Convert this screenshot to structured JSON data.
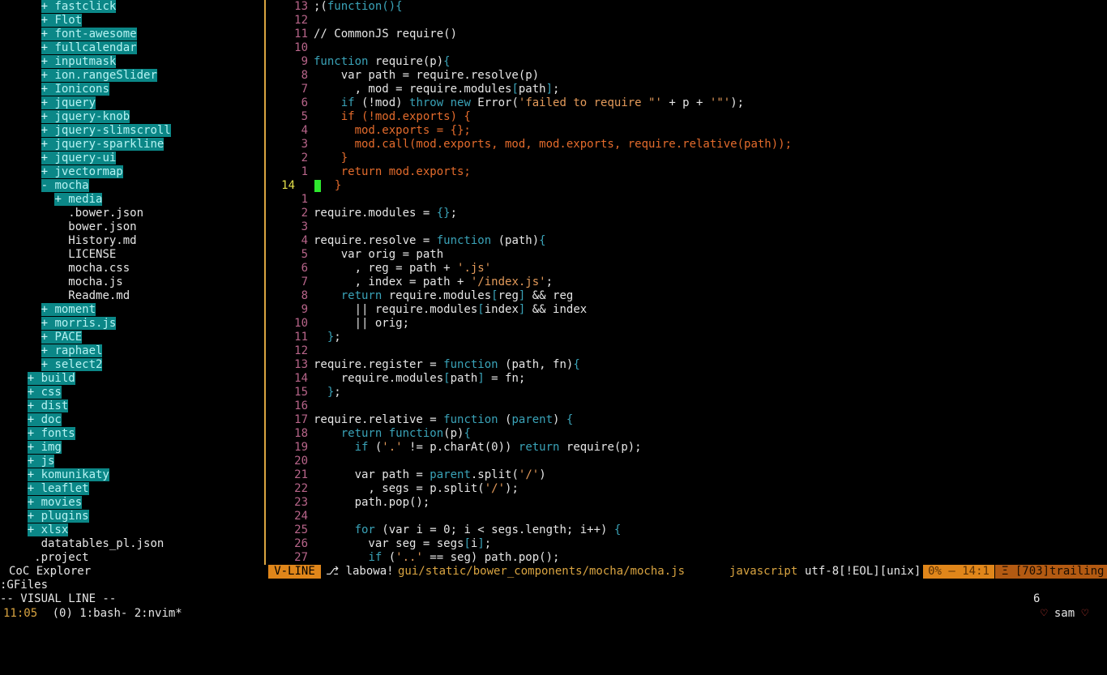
{
  "colors": {
    "accent": "#d9a441",
    "dir_bg": "#0b8787",
    "keyword": "#3aa3b8",
    "string": "#e39a5a",
    "visual": "#e36b2c",
    "line_number": "#b8658a",
    "cursor": "#2ee82e"
  },
  "explorer": {
    "title": "CoC Explorer",
    "rows": [
      {
        "indent": "      ",
        "sign": "+",
        "name": "fastclick",
        "type": "dir"
      },
      {
        "indent": "      ",
        "sign": "+",
        "name": "Flot",
        "type": "dir"
      },
      {
        "indent": "      ",
        "sign": "+",
        "name": "font-awesome",
        "type": "dir"
      },
      {
        "indent": "      ",
        "sign": "+",
        "name": "fullcalendar",
        "type": "dir"
      },
      {
        "indent": "      ",
        "sign": "+",
        "name": "inputmask",
        "type": "dir"
      },
      {
        "indent": "      ",
        "sign": "+",
        "name": "ion.rangeSlider",
        "type": "dir"
      },
      {
        "indent": "      ",
        "sign": "+",
        "name": "Ionicons",
        "type": "dir"
      },
      {
        "indent": "      ",
        "sign": "+",
        "name": "jquery",
        "type": "dir"
      },
      {
        "indent": "      ",
        "sign": "+",
        "name": "jquery-knob",
        "type": "dir"
      },
      {
        "indent": "      ",
        "sign": "+",
        "name": "jquery-slimscroll",
        "type": "dir"
      },
      {
        "indent": "      ",
        "sign": "+",
        "name": "jquery-sparkline",
        "type": "dir"
      },
      {
        "indent": "      ",
        "sign": "+",
        "name": "jquery-ui",
        "type": "dir"
      },
      {
        "indent": "      ",
        "sign": "+",
        "name": "jvectormap",
        "type": "dir"
      },
      {
        "indent": "      ",
        "sign": "-",
        "name": "mocha",
        "type": "dir"
      },
      {
        "indent": "        ",
        "sign": "+",
        "name": "media",
        "type": "dir"
      },
      {
        "indent": "          ",
        "sign": "",
        "name": ".bower.json",
        "type": "file"
      },
      {
        "indent": "          ",
        "sign": "",
        "name": "bower.json",
        "type": "file"
      },
      {
        "indent": "          ",
        "sign": "",
        "name": "History.md",
        "type": "file"
      },
      {
        "indent": "          ",
        "sign": "",
        "name": "LICENSE",
        "type": "file"
      },
      {
        "indent": "          ",
        "sign": "",
        "name": "mocha.css",
        "type": "file"
      },
      {
        "indent": "          ",
        "sign": "",
        "name": "mocha.js",
        "type": "file"
      },
      {
        "indent": "          ",
        "sign": "",
        "name": "Readme.md",
        "type": "file"
      },
      {
        "indent": "      ",
        "sign": "+",
        "name": "moment",
        "type": "dir"
      },
      {
        "indent": "      ",
        "sign": "+",
        "name": "morris.js",
        "type": "dir"
      },
      {
        "indent": "      ",
        "sign": "+",
        "name": "PACE",
        "type": "dir"
      },
      {
        "indent": "      ",
        "sign": "+",
        "name": "raphael",
        "type": "dir"
      },
      {
        "indent": "      ",
        "sign": "+",
        "name": "select2",
        "type": "dir"
      },
      {
        "indent": "    ",
        "sign": "+",
        "name": "build",
        "type": "dir"
      },
      {
        "indent": "    ",
        "sign": "+",
        "name": "css",
        "type": "dir"
      },
      {
        "indent": "    ",
        "sign": "+",
        "name": "dist",
        "type": "dir"
      },
      {
        "indent": "    ",
        "sign": "+",
        "name": "doc",
        "type": "dir"
      },
      {
        "indent": "    ",
        "sign": "+",
        "name": "fonts",
        "type": "dir"
      },
      {
        "indent": "    ",
        "sign": "+",
        "name": "img",
        "type": "dir"
      },
      {
        "indent": "    ",
        "sign": "+",
        "name": "js",
        "type": "dir"
      },
      {
        "indent": "    ",
        "sign": "+",
        "name": "komunikaty",
        "type": "dir"
      },
      {
        "indent": "    ",
        "sign": "+",
        "name": "leaflet",
        "type": "dir"
      },
      {
        "indent": "    ",
        "sign": "+",
        "name": "movies",
        "type": "dir"
      },
      {
        "indent": "    ",
        "sign": "+",
        "name": "plugins",
        "type": "dir"
      },
      {
        "indent": "    ",
        "sign": "+",
        "name": "xlsx",
        "type": "dir"
      },
      {
        "indent": "      ",
        "sign": "",
        "name": "datatables_pl.json",
        "type": "file"
      },
      {
        "indent": "     ",
        "sign": "",
        "name": ".project",
        "type": "file"
      }
    ]
  },
  "editor": {
    "lines": [
      {
        "n": "13",
        "cur": false,
        "parts": [
          [
            ";(",
            "fn"
          ],
          [
            "function",
            "kw"
          ],
          [
            "(){",
            "br"
          ]
        ]
      },
      {
        "n": "12",
        "cur": false,
        "parts": []
      },
      {
        "n": "11",
        "cur": false,
        "parts": [
          [
            "// CommonJS require()",
            "fn"
          ]
        ]
      },
      {
        "n": "10",
        "cur": false,
        "parts": []
      },
      {
        "n": "9",
        "cur": false,
        "parts": [
          [
            "function",
            "kw"
          ],
          [
            " require(p)",
            "fn"
          ],
          [
            "{",
            "br"
          ]
        ]
      },
      {
        "n": "8",
        "cur": false,
        "parts": [
          [
            "    var path = require.resolve(p)",
            "fn"
          ]
        ]
      },
      {
        "n": "7",
        "cur": false,
        "parts": [
          [
            "      , mod = require.modules",
            "fn"
          ],
          [
            "[",
            "br"
          ],
          [
            "path",
            "fn"
          ],
          [
            "]",
            "br"
          ],
          [
            ";",
            "fn"
          ]
        ]
      },
      {
        "n": "6",
        "cur": false,
        "parts": [
          [
            "    ",
            "fn"
          ],
          [
            "if",
            "kw"
          ],
          [
            " (!mod) ",
            "fn"
          ],
          [
            "throw new",
            "kw"
          ],
          [
            " Error(",
            "fn"
          ],
          [
            "'failed to require \"' ",
            "str"
          ],
          [
            "+ p + ",
            "fn"
          ],
          [
            "'\"'",
            "str"
          ],
          [
            ");",
            "fn"
          ]
        ]
      },
      {
        "n": "5",
        "cur": false,
        "parts": [
          [
            "    if (!mod.exports) {",
            "vis"
          ]
        ]
      },
      {
        "n": "4",
        "cur": false,
        "parts": [
          [
            "      mod.exports = {};",
            "vis"
          ]
        ]
      },
      {
        "n": "3",
        "cur": false,
        "parts": [
          [
            "      mod.call(mod.exports, mod, mod.exports, require.relative(path));",
            "vis"
          ]
        ]
      },
      {
        "n": "2",
        "cur": false,
        "parts": [
          [
            "    }",
            "vis"
          ]
        ]
      },
      {
        "n": "1",
        "cur": false,
        "parts": [
          [
            "    return mod.exports;",
            "vis"
          ]
        ]
      },
      {
        "n": "14",
        "cur": true,
        "parts": [
          [
            "  }",
            "vis"
          ]
        ]
      },
      {
        "n": "1",
        "cur": false,
        "parts": []
      },
      {
        "n": "2",
        "cur": false,
        "parts": [
          [
            "require.modules = ",
            "fn"
          ],
          [
            "{}",
            "br"
          ],
          [
            ";",
            "fn"
          ]
        ]
      },
      {
        "n": "3",
        "cur": false,
        "parts": []
      },
      {
        "n": "4",
        "cur": false,
        "parts": [
          [
            "require.resolve = ",
            "fn"
          ],
          [
            "function",
            "kw"
          ],
          [
            " (path)",
            "fn"
          ],
          [
            "{",
            "br"
          ]
        ]
      },
      {
        "n": "5",
        "cur": false,
        "parts": [
          [
            "    var orig = path",
            "fn"
          ]
        ]
      },
      {
        "n": "6",
        "cur": false,
        "parts": [
          [
            "      , reg = path + ",
            "fn"
          ],
          [
            "'.js'",
            "str"
          ]
        ]
      },
      {
        "n": "7",
        "cur": false,
        "parts": [
          [
            "      , index = path + ",
            "fn"
          ],
          [
            "'/index.js'",
            "str"
          ],
          [
            ";",
            "fn"
          ]
        ]
      },
      {
        "n": "8",
        "cur": false,
        "parts": [
          [
            "    ",
            "fn"
          ],
          [
            "return",
            "kw"
          ],
          [
            " require.modules",
            "fn"
          ],
          [
            "[",
            "br"
          ],
          [
            "reg",
            "fn"
          ],
          [
            "]",
            "br"
          ],
          [
            " && reg",
            "fn"
          ]
        ]
      },
      {
        "n": "9",
        "cur": false,
        "parts": [
          [
            "      || require.modules",
            "fn"
          ],
          [
            "[",
            "br"
          ],
          [
            "index",
            "fn"
          ],
          [
            "]",
            "br"
          ],
          [
            " && index",
            "fn"
          ]
        ]
      },
      {
        "n": "10",
        "cur": false,
        "parts": [
          [
            "      || orig;",
            "fn"
          ]
        ]
      },
      {
        "n": "11",
        "cur": false,
        "parts": [
          [
            "  ",
            "fn"
          ],
          [
            "}",
            "br"
          ],
          [
            ";",
            "fn"
          ]
        ]
      },
      {
        "n": "12",
        "cur": false,
        "parts": []
      },
      {
        "n": "13",
        "cur": false,
        "parts": [
          [
            "require.register = ",
            "fn"
          ],
          [
            "function",
            "kw"
          ],
          [
            " (path, fn)",
            "fn"
          ],
          [
            "{",
            "br"
          ]
        ]
      },
      {
        "n": "14",
        "cur": false,
        "parts": [
          [
            "    require.modules",
            "fn"
          ],
          [
            "[",
            "br"
          ],
          [
            "path",
            "fn"
          ],
          [
            "]",
            "br"
          ],
          [
            " = fn;",
            "fn"
          ]
        ]
      },
      {
        "n": "15",
        "cur": false,
        "parts": [
          [
            "  ",
            "fn"
          ],
          [
            "}",
            "br"
          ],
          [
            ";",
            "fn"
          ]
        ]
      },
      {
        "n": "16",
        "cur": false,
        "parts": []
      },
      {
        "n": "17",
        "cur": false,
        "parts": [
          [
            "require.relative = ",
            "fn"
          ],
          [
            "function",
            "kw"
          ],
          [
            " (",
            "fn"
          ],
          [
            "parent",
            "kw"
          ],
          [
            ") ",
            "fn"
          ],
          [
            "{",
            "br"
          ]
        ]
      },
      {
        "n": "18",
        "cur": false,
        "parts": [
          [
            "    ",
            "fn"
          ],
          [
            "return function",
            "kw"
          ],
          [
            "(p)",
            "fn"
          ],
          [
            "{",
            "br"
          ]
        ]
      },
      {
        "n": "19",
        "cur": false,
        "parts": [
          [
            "      ",
            "fn"
          ],
          [
            "if",
            "kw"
          ],
          [
            " (",
            "fn"
          ],
          [
            "'.'",
            "str"
          ],
          [
            " != p.charAt(0)) ",
            "fn"
          ],
          [
            "return",
            "kw"
          ],
          [
            " require(p);",
            "fn"
          ]
        ]
      },
      {
        "n": "20",
        "cur": false,
        "parts": []
      },
      {
        "n": "21",
        "cur": false,
        "parts": [
          [
            "      var path = ",
            "fn"
          ],
          [
            "parent",
            "kw"
          ],
          [
            ".split(",
            "fn"
          ],
          [
            "'/'",
            "str"
          ],
          [
            ")",
            "fn"
          ]
        ]
      },
      {
        "n": "22",
        "cur": false,
        "parts": [
          [
            "        , segs = p.split(",
            "fn"
          ],
          [
            "'/'",
            "str"
          ],
          [
            ");",
            "fn"
          ]
        ]
      },
      {
        "n": "23",
        "cur": false,
        "parts": [
          [
            "      path.pop();",
            "fn"
          ]
        ]
      },
      {
        "n": "24",
        "cur": false,
        "parts": []
      },
      {
        "n": "25",
        "cur": false,
        "parts": [
          [
            "      ",
            "fn"
          ],
          [
            "for",
            "kw"
          ],
          [
            " (var i = 0; i < segs.length; i++) ",
            "fn"
          ],
          [
            "{",
            "br"
          ]
        ]
      },
      {
        "n": "26",
        "cur": false,
        "parts": [
          [
            "        var seg = segs",
            "fn"
          ],
          [
            "[",
            "br"
          ],
          [
            "i",
            "fn"
          ],
          [
            "]",
            "br"
          ],
          [
            ";",
            "fn"
          ]
        ]
      },
      {
        "n": "27",
        "cur": false,
        "parts": [
          [
            "        ",
            "fn"
          ],
          [
            "if",
            "kw"
          ],
          [
            " (",
            "fn"
          ],
          [
            "'..'",
            "str"
          ],
          [
            " == seg) path.pop();",
            "fn"
          ]
        ]
      }
    ]
  },
  "statusline": {
    "mode": "V-LINE",
    "branch_icon": "branch-icon",
    "branch": "labowa!",
    "file": "gui/static/bower_components/mocha/mocha.js",
    "filetype": "javascript",
    "encoding": "utf-8[!EOL][unix]",
    "position": "0% — 14:1",
    "trailing": "Ξ [703]trailing"
  },
  "cmdline": ":GFiles",
  "modeline": {
    "mode": "-- VISUAL LINE --",
    "count": "6"
  },
  "tmux": {
    "time": "11:05",
    "windows": "(0) 1:bash- 2:nvim*",
    "user": "sam"
  }
}
